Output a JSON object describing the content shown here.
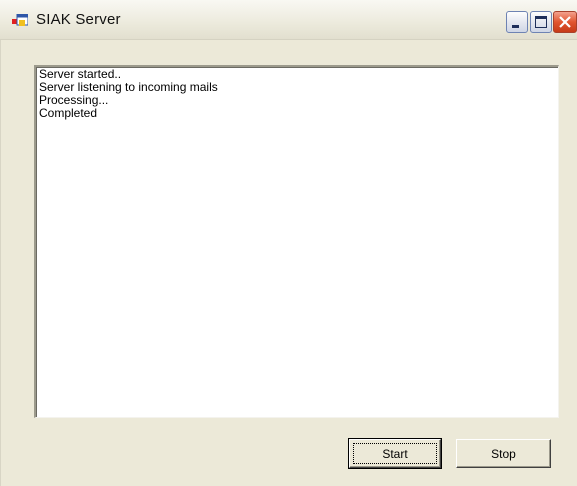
{
  "window": {
    "title": "SIAK Server"
  },
  "log": {
    "lines": [
      "Server started..",
      "Server listening to incoming mails",
      "Processing...",
      "Completed"
    ]
  },
  "buttons": {
    "start_label": "Start",
    "stop_label": "Stop"
  },
  "icons": {
    "app": "windows-form-icon",
    "minimize": "minimize-icon",
    "maximize": "maximize-icon",
    "close": "close-icon"
  },
  "colors": {
    "close_button": "#e1552f",
    "titlebar": "#eceadc",
    "client": "#ece9d8"
  }
}
